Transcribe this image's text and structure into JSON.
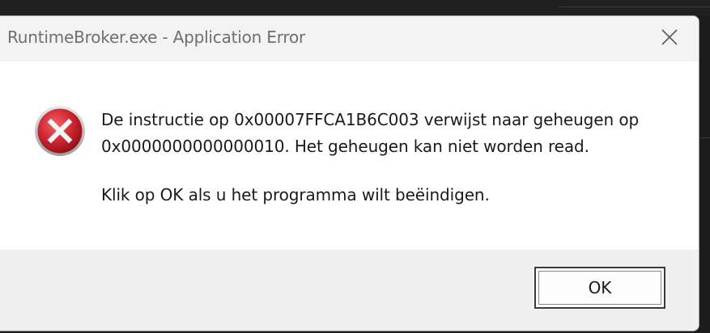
{
  "dialog": {
    "title": "RuntimeBroker.exe - Application Error",
    "close_icon": "close-icon",
    "error_icon": "error-x-icon",
    "message_line1": "De instructie op 0x00007FFCA1B6C003 verwijst naar geheugen op",
    "message_line2": "0x0000000000000010. Het geheugen kan niet worden read.",
    "message_line3": "Klik op OK als u het programma wilt beëindigen.",
    "ok_label": "OK"
  },
  "colors": {
    "title_bar_bg": "#f3f3f3",
    "footer_bg": "#f0f0f0",
    "error_red": "#c8232c",
    "title_text": "#6f6f6f"
  }
}
